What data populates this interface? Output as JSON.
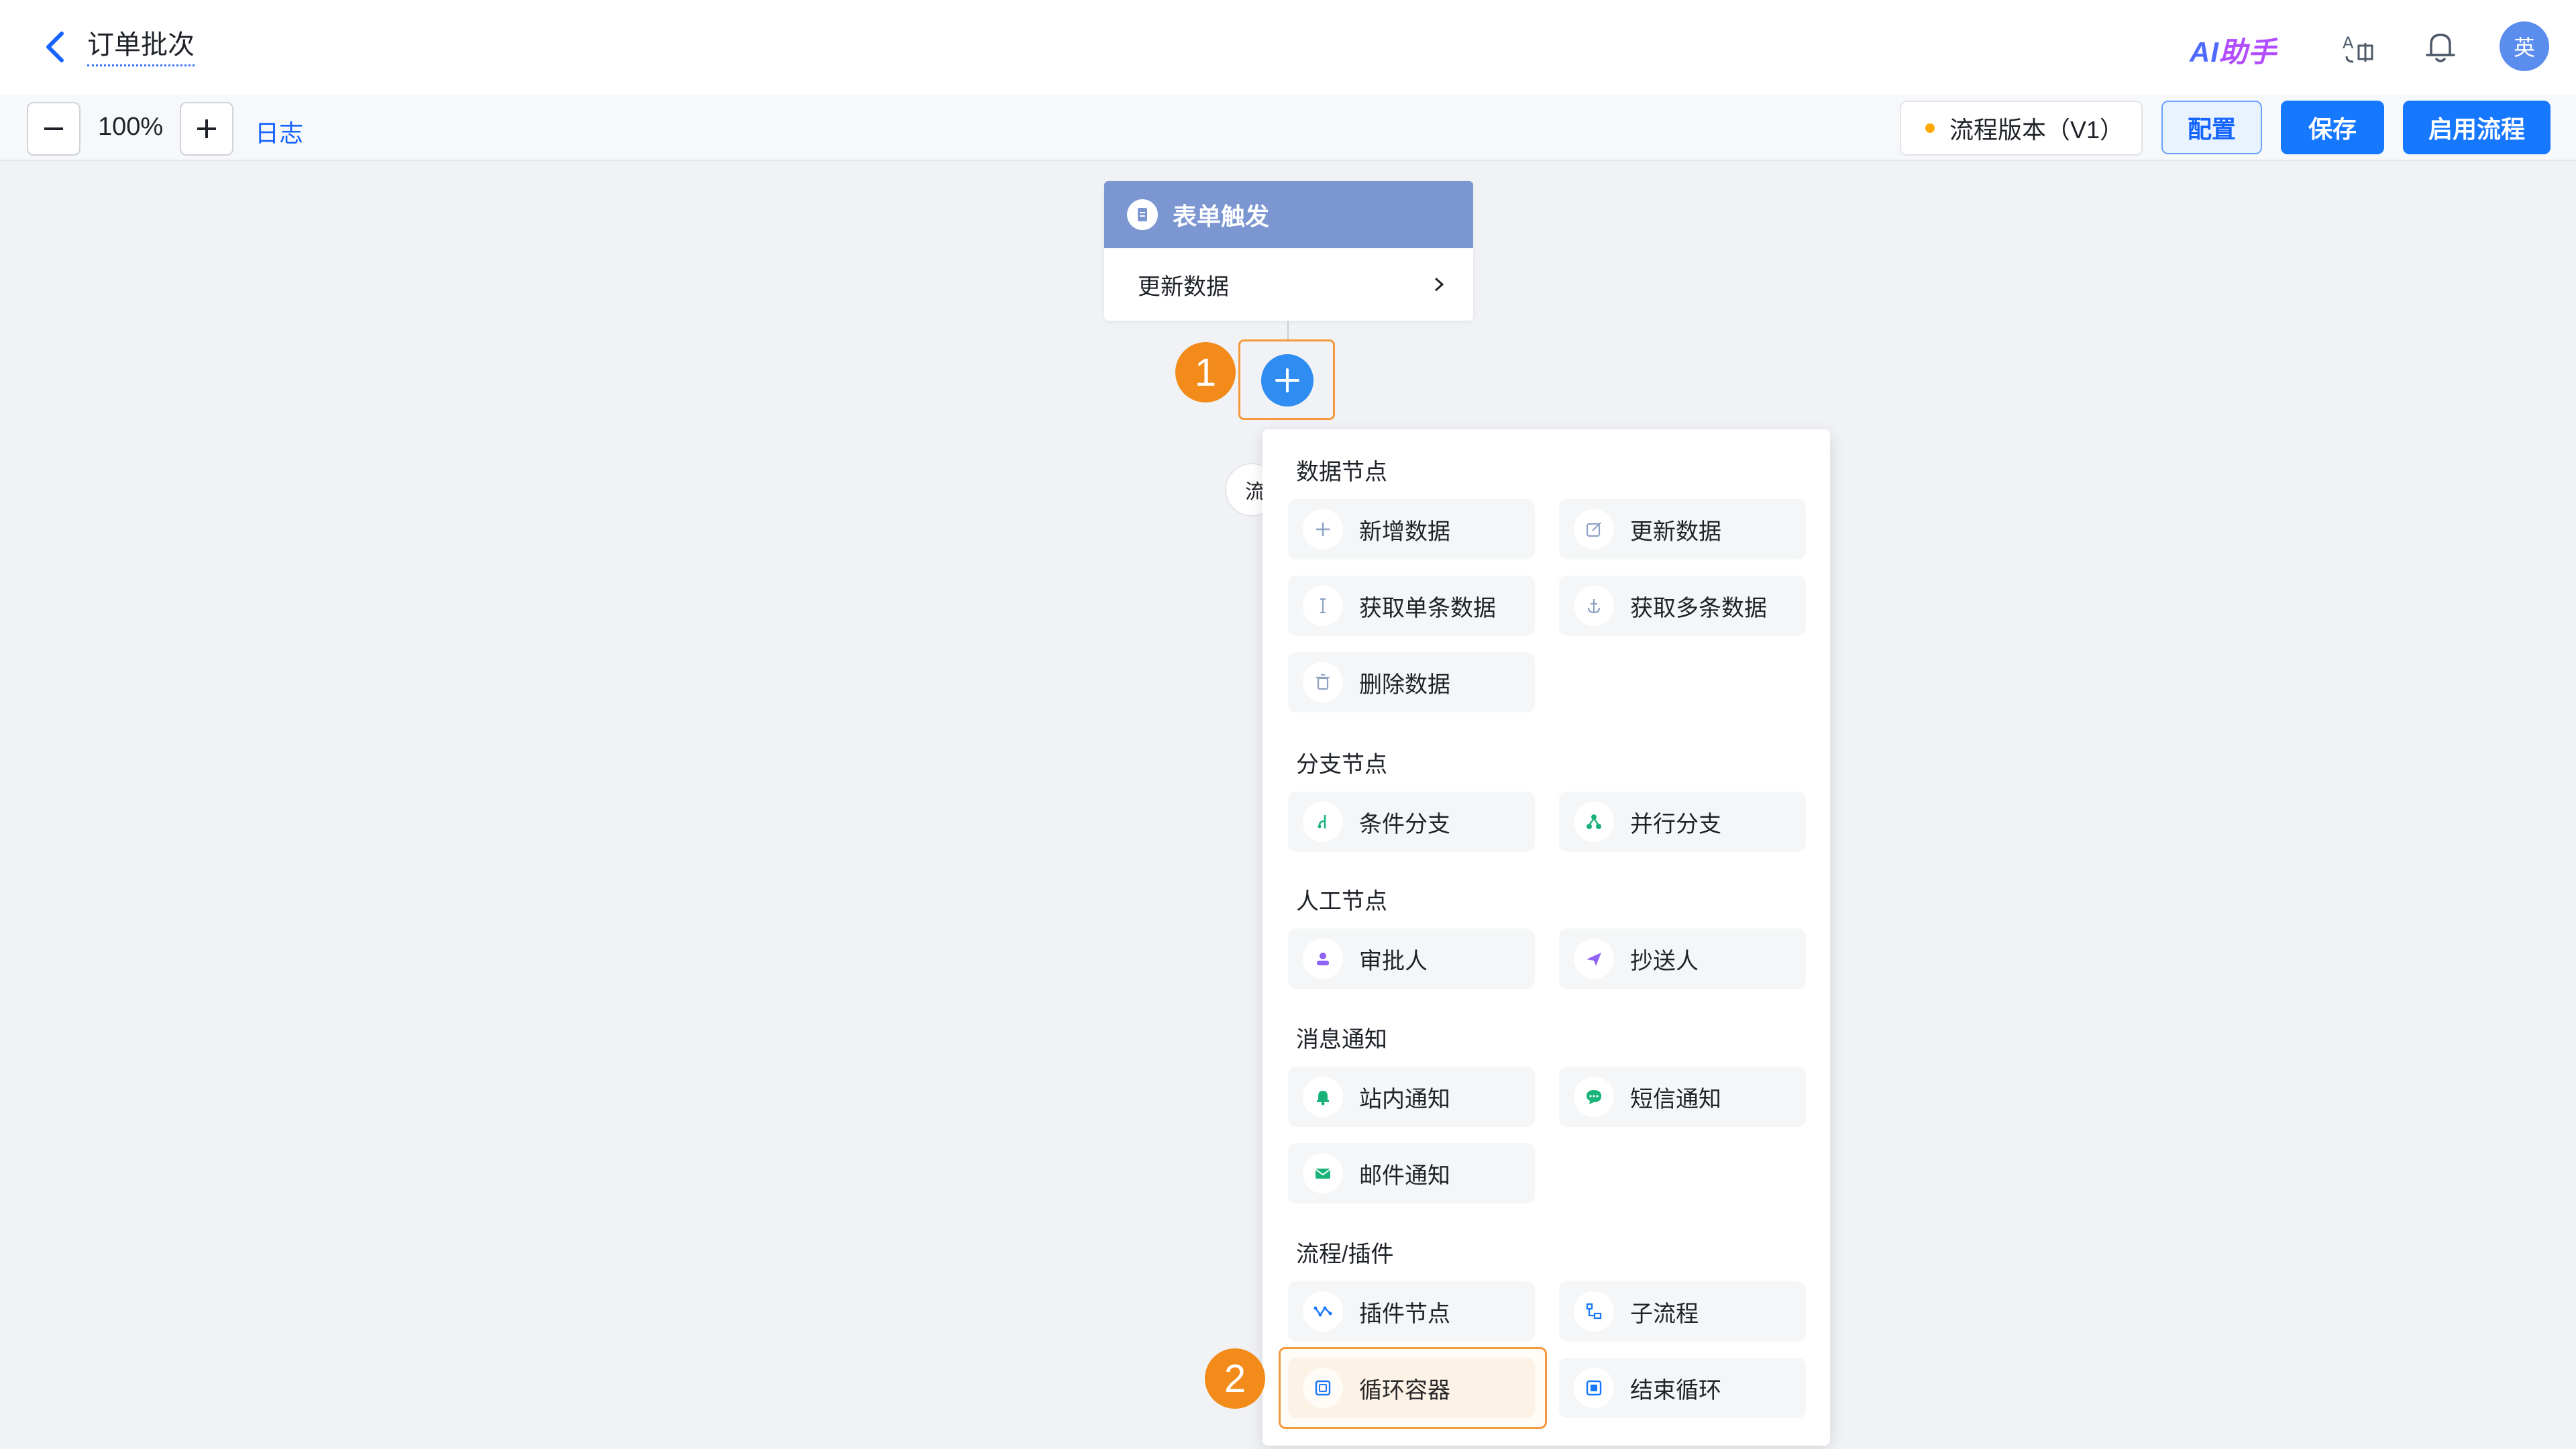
{
  "header": {
    "title": "订单批次",
    "ai_helper_prefix": "AI",
    "ai_helper_suffix": "助手",
    "avatar_text": "英"
  },
  "toolbar": {
    "zoom_level": "100%",
    "log_label": "日志",
    "version_label": "流程版本（V1）",
    "config_label": "配置",
    "save_label": "保存",
    "enable_label": "启用流程",
    "colors": {
      "primary": "#1677ff",
      "version_dot": "#ffa800"
    }
  },
  "canvas": {
    "trigger": {
      "title": "表单触发",
      "action": "更新数据"
    },
    "hidden_pill_text": "流",
    "annotations": [
      "1",
      "2"
    ]
  },
  "menu": {
    "sections": [
      {
        "title": "数据节点",
        "items": [
          {
            "label": "新增数据",
            "icon": "plus-icon"
          },
          {
            "label": "更新数据",
            "icon": "edit-icon"
          },
          {
            "label": "获取单条数据",
            "icon": "single-data-icon"
          },
          {
            "label": "获取多条数据",
            "icon": "multi-data-icon"
          },
          {
            "label": "删除数据",
            "icon": "trash-icon"
          }
        ]
      },
      {
        "title": "分支节点",
        "items": [
          {
            "label": "条件分支",
            "icon": "condition-branch-icon"
          },
          {
            "label": "并行分支",
            "icon": "parallel-branch-icon"
          }
        ]
      },
      {
        "title": "人工节点",
        "items": [
          {
            "label": "审批人",
            "icon": "approver-icon"
          },
          {
            "label": "抄送人",
            "icon": "send-icon"
          }
        ]
      },
      {
        "title": "消息通知",
        "items": [
          {
            "label": "站内通知",
            "icon": "bell-icon"
          },
          {
            "label": "短信通知",
            "icon": "sms-icon"
          },
          {
            "label": "邮件通知",
            "icon": "mail-icon"
          }
        ]
      },
      {
        "title": "流程/插件",
        "items": [
          {
            "label": "插件节点",
            "icon": "plugin-icon"
          },
          {
            "label": "子流程",
            "icon": "subprocess-icon"
          },
          {
            "label": "循环容器",
            "icon": "loop-container-icon"
          },
          {
            "label": "结束循环",
            "icon": "end-loop-icon"
          }
        ]
      }
    ]
  }
}
